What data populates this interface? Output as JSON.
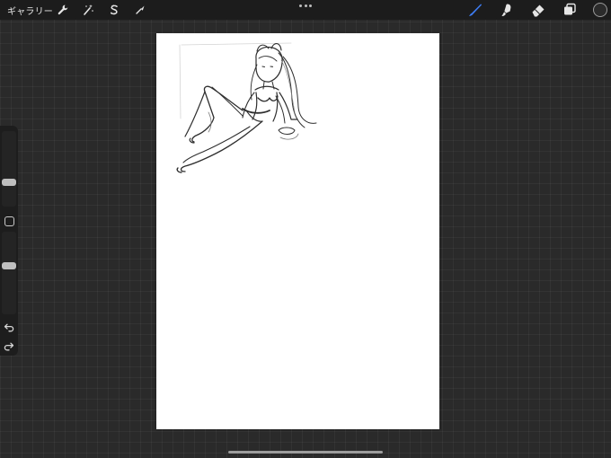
{
  "topbar": {
    "gallery_label": "ギャラリー",
    "left_tools": [
      {
        "name": "actions",
        "icon": "wrench-icon"
      },
      {
        "name": "adjustments",
        "icon": "magic-wand-icon"
      },
      {
        "name": "selection",
        "icon": "selection-s-icon"
      },
      {
        "name": "transform",
        "icon": "transform-arrow-icon"
      }
    ],
    "more_icon": "more-dots-icon",
    "right_tools": [
      {
        "name": "brush",
        "icon": "brush-icon",
        "active": true
      },
      {
        "name": "smudge",
        "icon": "smudge-icon",
        "active": false
      },
      {
        "name": "eraser",
        "icon": "eraser-icon",
        "active": false
      },
      {
        "name": "layers",
        "icon": "layers-icon",
        "active": false
      }
    ],
    "active_color": "#2b2b2b",
    "accent_color": "#3d7bf0"
  },
  "sidebar": {
    "brush_size_level": 0.3,
    "opacity_level": 0.6,
    "modify_icon": "square-modify-icon",
    "undo_icon": "undo-icon",
    "redo_icon": "redo-icon"
  },
  "canvas": {
    "background": "#ffffff",
    "content": "pencil-sketch"
  }
}
